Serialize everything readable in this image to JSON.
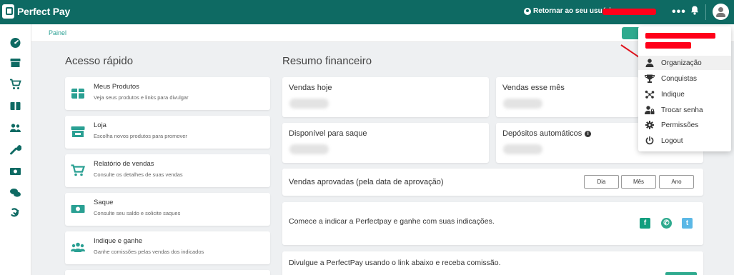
{
  "app": {
    "brand": "Perfect Pay"
  },
  "topbar": {
    "return_user_label": "Retornar ao seu usuário"
  },
  "sidebar": {
    "items": [
      {
        "icon": "dashboard-icon"
      },
      {
        "icon": "store-icon"
      },
      {
        "icon": "cart-icon"
      },
      {
        "icon": "box-icon"
      },
      {
        "icon": "users-icon"
      },
      {
        "icon": "wrench-icon"
      },
      {
        "icon": "money-icon"
      },
      {
        "icon": "chat-icon"
      },
      {
        "icon": "support-icon"
      }
    ]
  },
  "breadcrumb": {
    "label": "Painel"
  },
  "quick_access": {
    "title": "Acesso rápido",
    "cards": [
      {
        "title": "Meus Produtos",
        "desc": "Veja seus produtos e links para divulgar",
        "icon": "box-icon"
      },
      {
        "title": "Loja",
        "desc": "Escolha novos produtos para promover",
        "icon": "store-icon"
      },
      {
        "title": "Relatório de vendas",
        "desc": "Consulte os detalhes de suas vendas",
        "icon": "cart-icon"
      },
      {
        "title": "Saque",
        "desc": "Consulte seu saldo e solicite saques",
        "icon": "money-icon"
      },
      {
        "title": "Indique e ganhe",
        "desc": "Ganhe comissões pelas vendas dos indicados",
        "icon": "users-icon"
      }
    ]
  },
  "finance": {
    "title": "Resumo financeiro",
    "cards": [
      {
        "label": "Vendas hoje"
      },
      {
        "label": "Vendas esse mês"
      },
      {
        "label": "Disponível para saque"
      },
      {
        "label": "Depósitos automáticos"
      }
    ],
    "approved": {
      "label": "Vendas aprovadas (pela data de aprovação)",
      "periods": [
        "Dia",
        "Mês",
        "Ano"
      ]
    },
    "refer_text": "Comece a indicar a Perfectpay e ganhe com suas indicações.",
    "promote_text": "Divulgue a PerfectPay usando o link abaixo e receba comissão."
  },
  "colors": {
    "brand": "#0e6a63",
    "accent": "#2aa093",
    "redaction": "#ff0019"
  },
  "user_menu": {
    "items": [
      {
        "label": "Organização",
        "icon": "user-icon"
      },
      {
        "label": "Conquistas",
        "icon": "trophy-icon"
      },
      {
        "label": "Indique",
        "icon": "share-icon"
      },
      {
        "label": "Trocar senha",
        "icon": "user-lock-icon"
      },
      {
        "label": "Permissões",
        "icon": "gear-icon"
      },
      {
        "label": "Logout",
        "icon": "power-icon"
      }
    ]
  }
}
